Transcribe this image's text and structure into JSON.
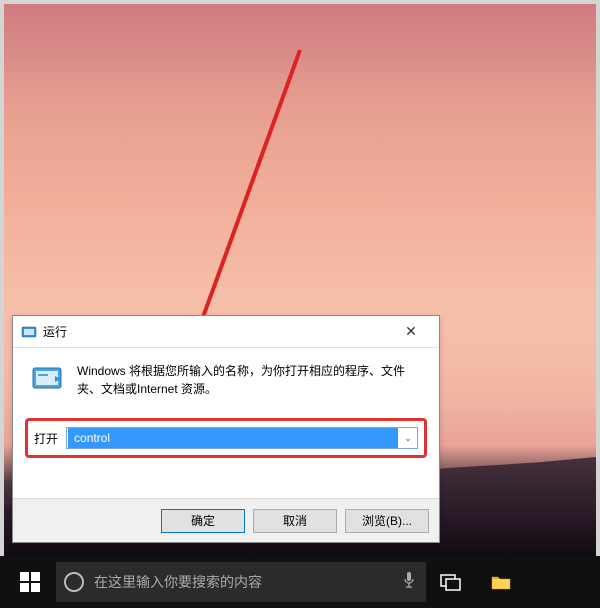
{
  "run_dialog": {
    "title": "运行",
    "description": "Windows 将根据您所输入的名称，为你打开相应的程序、文件夹、文档或Internet 资源。",
    "open_label": "打开",
    "input_value": "control",
    "ok_label": "确定",
    "cancel_label": "取消",
    "browse_label": "浏览(B)..."
  },
  "taskbar": {
    "search_placeholder": "在这里输入你要搜索的内容"
  },
  "annotation": {
    "highlight_color": "#d33",
    "arrow_color": "#d22"
  }
}
